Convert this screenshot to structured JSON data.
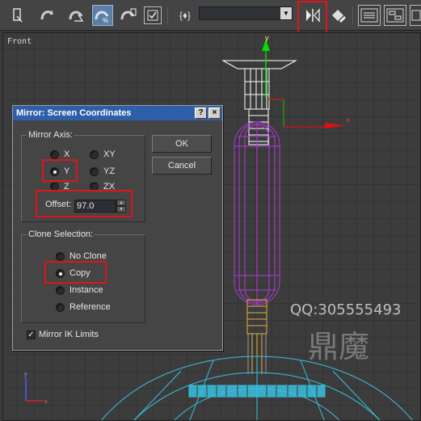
{
  "viewport": {
    "label": "Front",
    "axis_y": "y",
    "axis_x": "x",
    "gizmo_y": "y",
    "gizmo_x": "x"
  },
  "watermark": {
    "qq": "QQ:305555493",
    "chinese": "鼎魔"
  },
  "toolbar": {
    "icons": [
      "select-icon",
      "snap-3d-icon",
      "angle-snap-icon",
      "percent-snap-icon",
      "spinner-snap-icon",
      "edit-named-selection-icon",
      "mirror-icon",
      "align-icon",
      "layer-manager-icon",
      "curve-editor-icon",
      "schematic-view-icon"
    ],
    "named_selection_bracket": "{♦}",
    "named_selection_value": ""
  },
  "dialog": {
    "title": "Mirror: Screen Coordinates",
    "help_label": "?",
    "close_label": "×",
    "mirror_axis": {
      "title": "Mirror Axis:",
      "options": [
        "X",
        "Y",
        "Z",
        "XY",
        "YZ",
        "ZX"
      ],
      "selected": "Y"
    },
    "offset_label": "Offset:",
    "offset_value": "97.0",
    "clone_selection": {
      "title": "Clone Selection:",
      "options": [
        "No Clone",
        "Copy",
        "Instance",
        "Reference"
      ],
      "selected": "Copy"
    },
    "mirror_ik_label": "Mirror IK Limits",
    "mirror_ik_checked": true,
    "ok_label": "OK",
    "cancel_label": "Cancel"
  },
  "colors": {
    "annotation_red": "#e0141c",
    "title_bar_blue": "#2e5fa8",
    "wire_white": "#ffffff",
    "wire_purple": "#b23ad6",
    "wire_yellow": "#e0b040",
    "wire_cyan": "#38c0e0"
  }
}
